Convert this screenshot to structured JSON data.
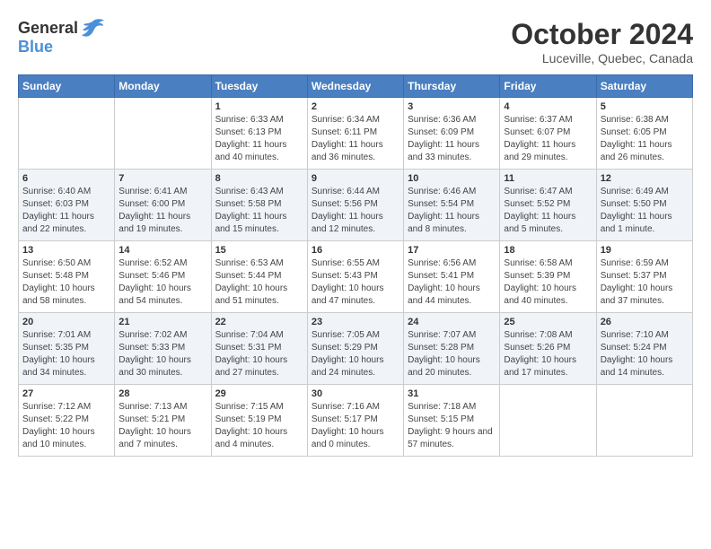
{
  "header": {
    "logo_general": "General",
    "logo_blue": "Blue",
    "month": "October 2024",
    "location": "Luceville, Quebec, Canada"
  },
  "days_of_week": [
    "Sunday",
    "Monday",
    "Tuesday",
    "Wednesday",
    "Thursday",
    "Friday",
    "Saturday"
  ],
  "weeks": [
    [
      {
        "day": "",
        "info": ""
      },
      {
        "day": "",
        "info": ""
      },
      {
        "day": "1",
        "info": "Sunrise: 6:33 AM\nSunset: 6:13 PM\nDaylight: 11 hours and 40 minutes."
      },
      {
        "day": "2",
        "info": "Sunrise: 6:34 AM\nSunset: 6:11 PM\nDaylight: 11 hours and 36 minutes."
      },
      {
        "day": "3",
        "info": "Sunrise: 6:36 AM\nSunset: 6:09 PM\nDaylight: 11 hours and 33 minutes."
      },
      {
        "day": "4",
        "info": "Sunrise: 6:37 AM\nSunset: 6:07 PM\nDaylight: 11 hours and 29 minutes."
      },
      {
        "day": "5",
        "info": "Sunrise: 6:38 AM\nSunset: 6:05 PM\nDaylight: 11 hours and 26 minutes."
      }
    ],
    [
      {
        "day": "6",
        "info": "Sunrise: 6:40 AM\nSunset: 6:03 PM\nDaylight: 11 hours and 22 minutes."
      },
      {
        "day": "7",
        "info": "Sunrise: 6:41 AM\nSunset: 6:00 PM\nDaylight: 11 hours and 19 minutes."
      },
      {
        "day": "8",
        "info": "Sunrise: 6:43 AM\nSunset: 5:58 PM\nDaylight: 11 hours and 15 minutes."
      },
      {
        "day": "9",
        "info": "Sunrise: 6:44 AM\nSunset: 5:56 PM\nDaylight: 11 hours and 12 minutes."
      },
      {
        "day": "10",
        "info": "Sunrise: 6:46 AM\nSunset: 5:54 PM\nDaylight: 11 hours and 8 minutes."
      },
      {
        "day": "11",
        "info": "Sunrise: 6:47 AM\nSunset: 5:52 PM\nDaylight: 11 hours and 5 minutes."
      },
      {
        "day": "12",
        "info": "Sunrise: 6:49 AM\nSunset: 5:50 PM\nDaylight: 11 hours and 1 minute."
      }
    ],
    [
      {
        "day": "13",
        "info": "Sunrise: 6:50 AM\nSunset: 5:48 PM\nDaylight: 10 hours and 58 minutes."
      },
      {
        "day": "14",
        "info": "Sunrise: 6:52 AM\nSunset: 5:46 PM\nDaylight: 10 hours and 54 minutes."
      },
      {
        "day": "15",
        "info": "Sunrise: 6:53 AM\nSunset: 5:44 PM\nDaylight: 10 hours and 51 minutes."
      },
      {
        "day": "16",
        "info": "Sunrise: 6:55 AM\nSunset: 5:43 PM\nDaylight: 10 hours and 47 minutes."
      },
      {
        "day": "17",
        "info": "Sunrise: 6:56 AM\nSunset: 5:41 PM\nDaylight: 10 hours and 44 minutes."
      },
      {
        "day": "18",
        "info": "Sunrise: 6:58 AM\nSunset: 5:39 PM\nDaylight: 10 hours and 40 minutes."
      },
      {
        "day": "19",
        "info": "Sunrise: 6:59 AM\nSunset: 5:37 PM\nDaylight: 10 hours and 37 minutes."
      }
    ],
    [
      {
        "day": "20",
        "info": "Sunrise: 7:01 AM\nSunset: 5:35 PM\nDaylight: 10 hours and 34 minutes."
      },
      {
        "day": "21",
        "info": "Sunrise: 7:02 AM\nSunset: 5:33 PM\nDaylight: 10 hours and 30 minutes."
      },
      {
        "day": "22",
        "info": "Sunrise: 7:04 AM\nSunset: 5:31 PM\nDaylight: 10 hours and 27 minutes."
      },
      {
        "day": "23",
        "info": "Sunrise: 7:05 AM\nSunset: 5:29 PM\nDaylight: 10 hours and 24 minutes."
      },
      {
        "day": "24",
        "info": "Sunrise: 7:07 AM\nSunset: 5:28 PM\nDaylight: 10 hours and 20 minutes."
      },
      {
        "day": "25",
        "info": "Sunrise: 7:08 AM\nSunset: 5:26 PM\nDaylight: 10 hours and 17 minutes."
      },
      {
        "day": "26",
        "info": "Sunrise: 7:10 AM\nSunset: 5:24 PM\nDaylight: 10 hours and 14 minutes."
      }
    ],
    [
      {
        "day": "27",
        "info": "Sunrise: 7:12 AM\nSunset: 5:22 PM\nDaylight: 10 hours and 10 minutes."
      },
      {
        "day": "28",
        "info": "Sunrise: 7:13 AM\nSunset: 5:21 PM\nDaylight: 10 hours and 7 minutes."
      },
      {
        "day": "29",
        "info": "Sunrise: 7:15 AM\nSunset: 5:19 PM\nDaylight: 10 hours and 4 minutes."
      },
      {
        "day": "30",
        "info": "Sunrise: 7:16 AM\nSunset: 5:17 PM\nDaylight: 10 hours and 0 minutes."
      },
      {
        "day": "31",
        "info": "Sunrise: 7:18 AM\nSunset: 5:15 PM\nDaylight: 9 hours and 57 minutes."
      },
      {
        "day": "",
        "info": ""
      },
      {
        "day": "",
        "info": ""
      }
    ]
  ]
}
